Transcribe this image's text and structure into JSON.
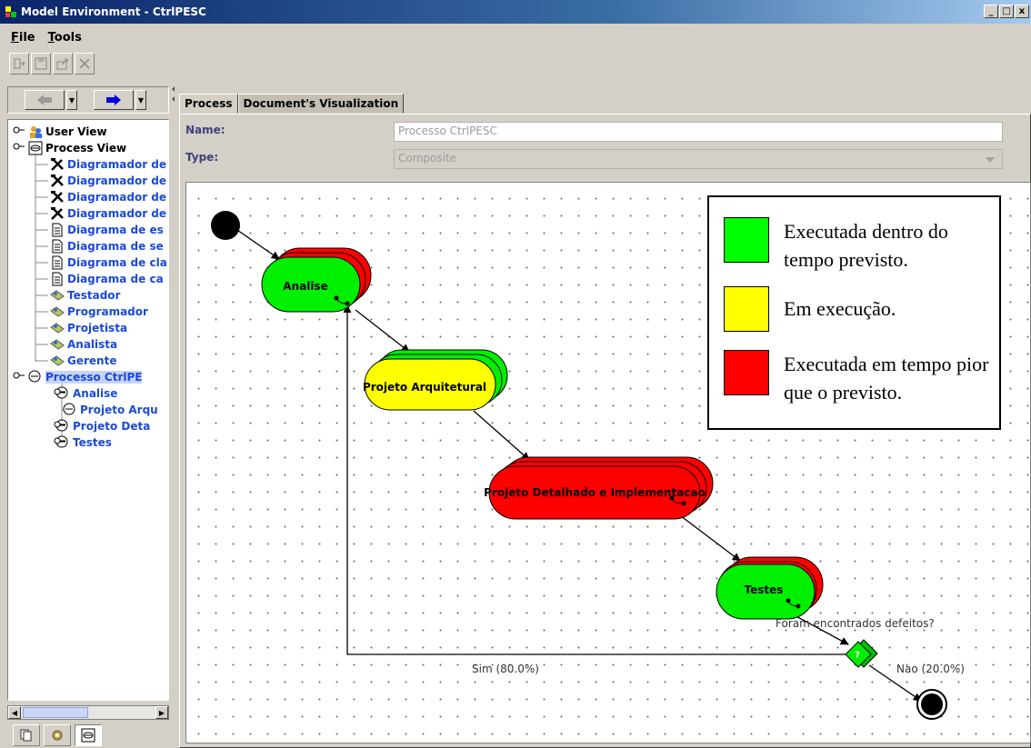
{
  "window": {
    "title": "Model Environment - CtrlPESC",
    "controls": [
      "_",
      "□",
      "x"
    ]
  },
  "menu": [
    "File",
    "Tools"
  ],
  "tree": {
    "items": [
      {
        "label": "User View",
        "icon": "users-icon",
        "color": "black"
      },
      {
        "label": "Process View",
        "icon": "process-view-icon",
        "color": "black"
      },
      {
        "label": "Diagramador de",
        "icon": "tools-icon",
        "color": "blue"
      },
      {
        "label": "Diagramador de",
        "icon": "tools-icon",
        "color": "blue"
      },
      {
        "label": "Diagramador de",
        "icon": "tools-icon",
        "color": "blue"
      },
      {
        "label": "Diagramador de",
        "icon": "tools-icon",
        "color": "blue"
      },
      {
        "label": "Diagrama de es",
        "icon": "document-icon",
        "color": "blue"
      },
      {
        "label": "Diagrama de se",
        "icon": "document-icon",
        "color": "blue"
      },
      {
        "label": "Diagrama de cla",
        "icon": "document-icon",
        "color": "blue"
      },
      {
        "label": "Diagrama de ca",
        "icon": "document-icon",
        "color": "blue"
      },
      {
        "label": "Testador",
        "icon": "role-icon",
        "color": "blue"
      },
      {
        "label": "Programador",
        "icon": "role-icon",
        "color": "blue"
      },
      {
        "label": "Projetista",
        "icon": "role-icon",
        "color": "blue"
      },
      {
        "label": "Analista",
        "icon": "role-icon",
        "color": "blue"
      },
      {
        "label": "Gerente",
        "icon": "role-icon",
        "color": "blue"
      },
      {
        "label": "Processo CtrlPE",
        "icon": "process-icon",
        "color": "blue"
      },
      {
        "label": "Analise",
        "icon": "process-icon",
        "color": "blue"
      },
      {
        "label": "Projeto Arqu",
        "icon": "process-icon",
        "color": "blue"
      },
      {
        "label": "Projeto Deta",
        "icon": "process-icon",
        "color": "blue"
      },
      {
        "label": "Testes",
        "icon": "process-icon",
        "color": "blue"
      }
    ]
  },
  "tabs": [
    {
      "label": "Process"
    },
    {
      "label": "Document's Visualization"
    }
  ],
  "form": {
    "name_label": "Name:",
    "name_value": "Processo CtrlPESC",
    "type_label": "Type:",
    "type_value": "Composite"
  },
  "diagram": {
    "nodes": [
      {
        "label": "Analise",
        "fill": "#00f000",
        "stack": "#ff0000"
      },
      {
        "label": "Projeto Arquitetural",
        "fill": "#ffff00",
        "stack": "#00f000"
      },
      {
        "label": "Projeto Detalhado e Implementacao",
        "fill": "#ff0000",
        "stack": "#ff0000"
      },
      {
        "label": "Testes",
        "fill": "#00f000",
        "stack": "#ff0000"
      }
    ],
    "decision": {
      "label": "?",
      "question": "Foram encontrados defeitos?"
    },
    "edges": {
      "yes": "Sim (80.0%)",
      "no": "Nao (20.0%)"
    }
  },
  "legend": [
    {
      "color": "#00ff00",
      "text": "Executada dentro do tempo previsto."
    },
    {
      "color": "#ffff00",
      "text": "Em execução."
    },
    {
      "color": "#ff0000",
      "text": "Executada em tempo pior que o previsto."
    }
  ]
}
